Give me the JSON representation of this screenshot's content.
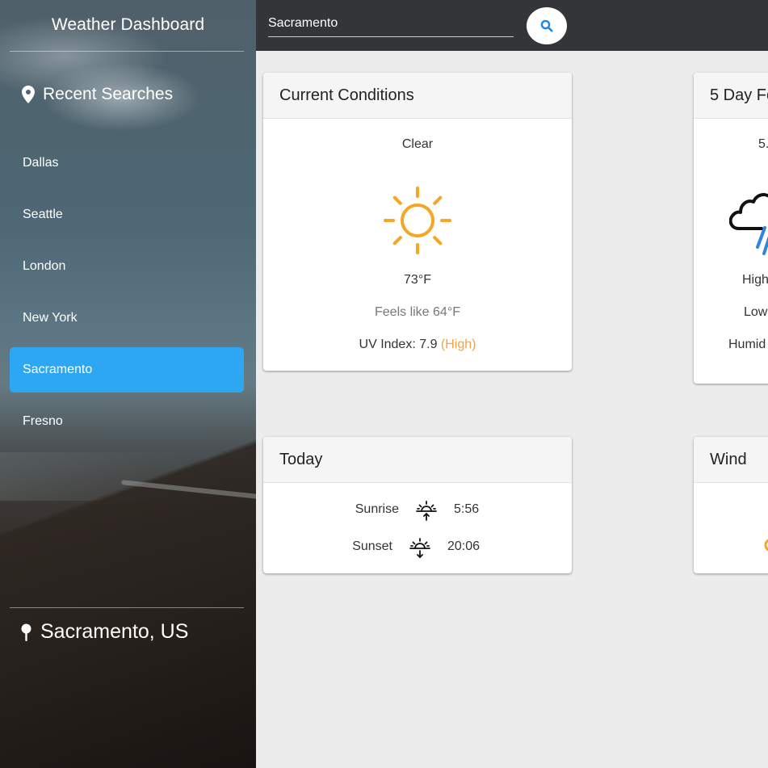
{
  "app": {
    "title": "Weather Dashboard"
  },
  "sidebar": {
    "recent_title": "Recent Searches",
    "items": [
      {
        "label": "Dallas"
      },
      {
        "label": "Seattle"
      },
      {
        "label": "London"
      },
      {
        "label": "New York"
      },
      {
        "label": "Sacramento",
        "active": true
      },
      {
        "label": "Fresno"
      }
    ],
    "current_location": "Sacramento, US"
  },
  "search": {
    "value": "Sacramento",
    "placeholder": ""
  },
  "colors": {
    "accent": "#2ea7f3",
    "topbar": "#333539",
    "sun": "#f5a623",
    "uv_high": "#f3a13d",
    "search_icon": "#1e88e5",
    "rain": "#2e86de"
  },
  "current": {
    "title": "Current Conditions",
    "condition": "Clear",
    "icon": "sun-icon",
    "temp": "73°F",
    "feels_like": "Feels like 64°F",
    "uv_label": "UV Index: 7.9",
    "uv_level": "(High)"
  },
  "forecast": {
    "title": "5 Day Fo",
    "date_partial": "5.",
    "icon": "rain-cloud-icon",
    "high_label": "High",
    "low_label": "Low",
    "humidity_label": "Humid"
  },
  "today": {
    "title": "Today",
    "sunrise_label": "Sunrise",
    "sunrise_time": "5:56",
    "sunset_label": "Sunset",
    "sunset_time": "20:06"
  },
  "wind": {
    "title": "Wind"
  }
}
